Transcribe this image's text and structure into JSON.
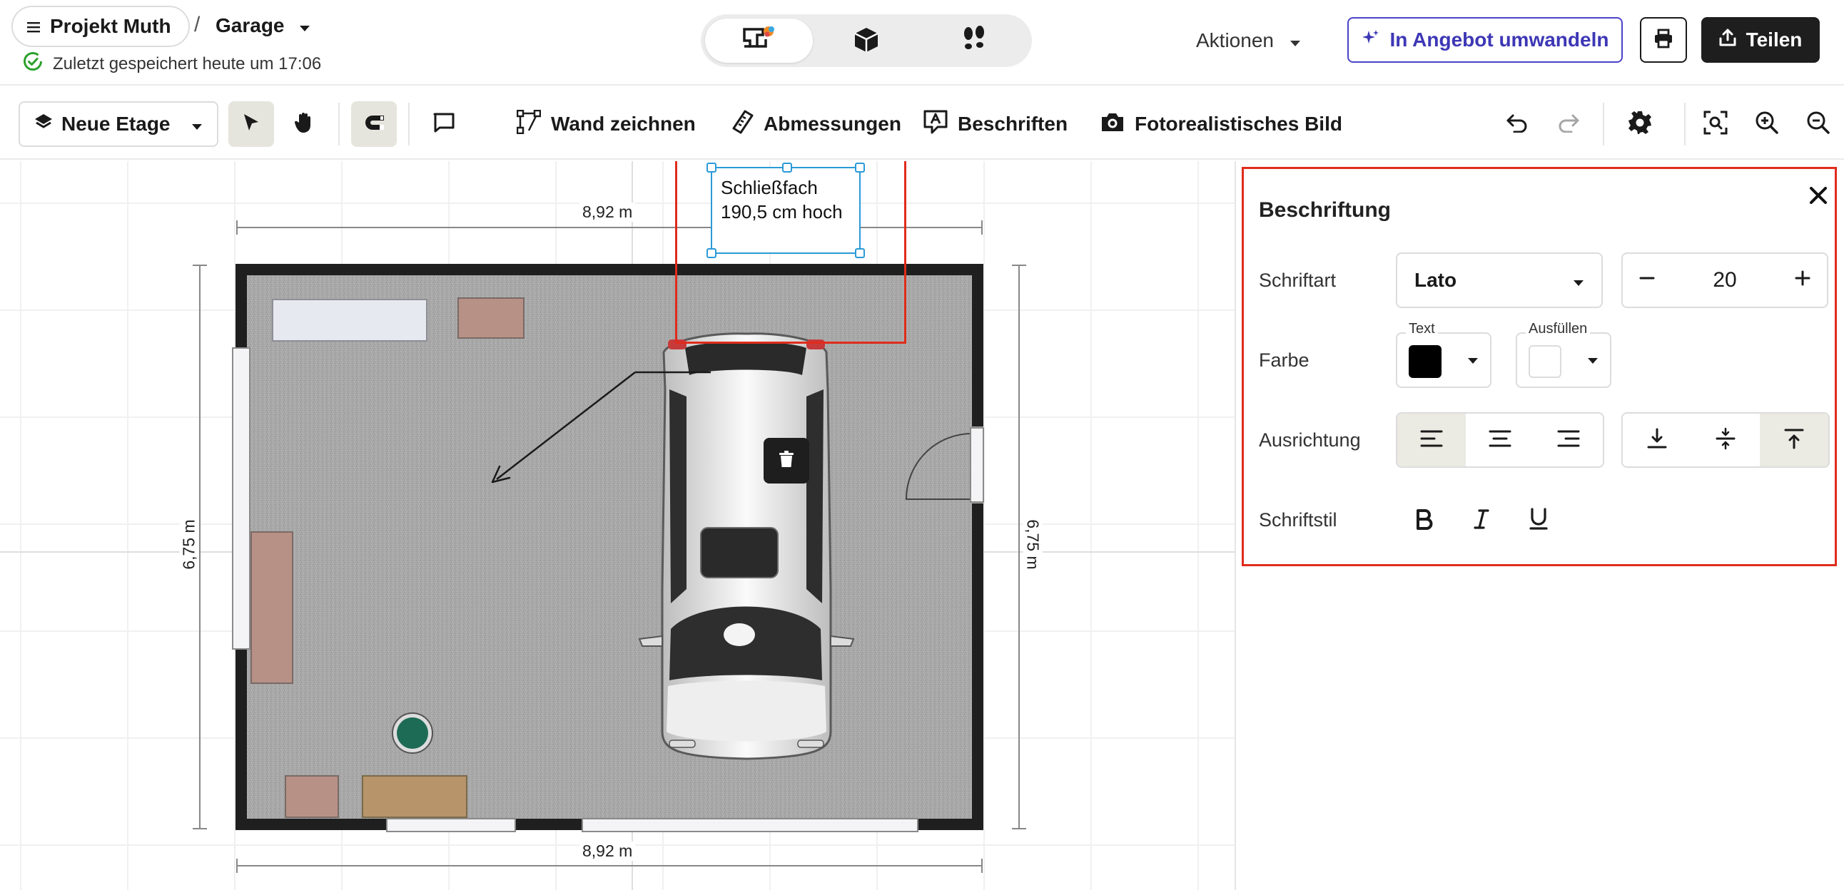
{
  "header": {
    "project_name": "Projekt Muth",
    "breadcrumb_separator": "/",
    "current_room": "Garage",
    "save_status": "Zuletzt gespeichert heute um 17:06",
    "view_modes": [
      "2D",
      "3D",
      "Walkthrough"
    ],
    "actions_label": "Aktionen",
    "convert_label": "In Angebot umwandeln",
    "share_label": "Teilen"
  },
  "toolbar": {
    "floor_label": "Neue Etage",
    "draw_wall_label": "Wand zeichnen",
    "dimensions_label": "Abmessungen",
    "labels_label": "Beschriften",
    "photo_label": "Fotorealistisches Bild"
  },
  "canvas": {
    "dim_top": "8,92 m",
    "dim_bottom": "8,92 m",
    "dim_left": "6,75 m",
    "dim_right": "6,75 m",
    "label_line1": "Schließfach",
    "label_line2": "190,5 cm hoch"
  },
  "panel": {
    "title": "Beschriftung",
    "font_label": "Schriftart",
    "font_value": "Lato",
    "font_size": "20",
    "color_label": "Farbe",
    "text_color_legend": "Text",
    "fill_color_legend": "Ausfüllen",
    "text_color": "#000000",
    "fill_color": "#ffffff",
    "alignment_label": "Ausrichtung",
    "style_label": "Schriftstil",
    "horizontal_align_selected": "left",
    "vertical_align_selected": "top"
  },
  "colors": {
    "accent": "#4a44c6",
    "highlight": "#e02b1c",
    "selection": "#2a9ad8",
    "dark_button": "#1e1e1e"
  }
}
